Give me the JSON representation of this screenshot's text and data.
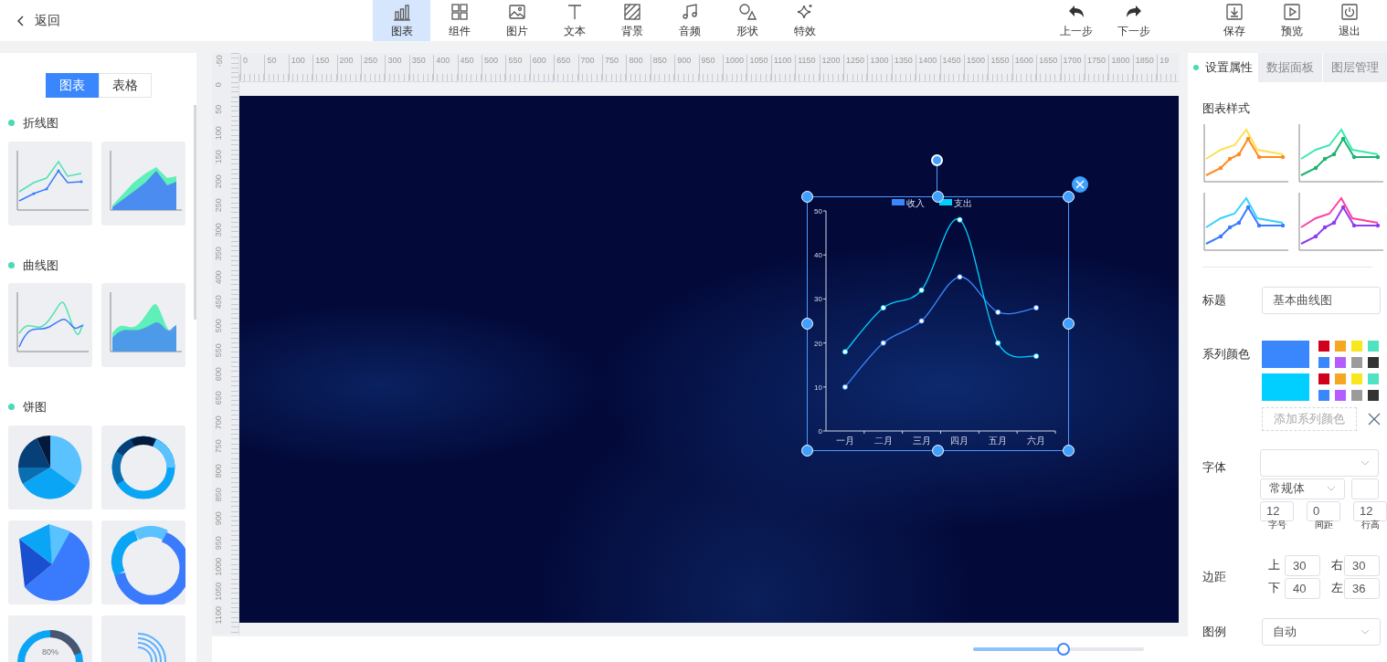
{
  "back": {
    "label": "返回"
  },
  "toolbar": {
    "tools": [
      {
        "label": "图表",
        "kind": "chart",
        "selected": true
      },
      {
        "label": "组件",
        "kind": "component",
        "selected": false
      },
      {
        "label": "图片",
        "kind": "image",
        "selected": false
      },
      {
        "label": "文本",
        "kind": "text",
        "selected": false
      },
      {
        "label": "背景",
        "kind": "background",
        "selected": false
      },
      {
        "label": "音频",
        "kind": "audio",
        "selected": false
      },
      {
        "label": "形状",
        "kind": "shape",
        "selected": false
      },
      {
        "label": "特效",
        "kind": "effect",
        "selected": false
      }
    ],
    "history": [
      {
        "label": "上一步",
        "kind": "undo"
      },
      {
        "label": "下一步",
        "kind": "redo"
      }
    ],
    "actions": [
      {
        "label": "保存",
        "kind": "save"
      },
      {
        "label": "预览",
        "kind": "preview"
      },
      {
        "label": "退出",
        "kind": "exit"
      }
    ]
  },
  "left_panel": {
    "tabs": [
      {
        "label": "图表",
        "selected": true
      },
      {
        "label": "表格",
        "selected": false
      }
    ],
    "sections": [
      {
        "title": "折线图",
        "items": [
          {
            "kind": "line"
          },
          {
            "kind": "area"
          }
        ]
      },
      {
        "title": "曲线图",
        "items": [
          {
            "kind": "curve"
          },
          {
            "kind": "curve-area"
          }
        ]
      },
      {
        "title": "饼图",
        "items": [
          {
            "kind": "pie"
          },
          {
            "kind": "donut"
          },
          {
            "kind": "rose-pie"
          },
          {
            "kind": "rose-donut"
          },
          {
            "kind": "gauge",
            "label": "80%"
          },
          {
            "kind": "radial-bars"
          }
        ]
      }
    ]
  },
  "rulers": {
    "horizontal": [
      "0",
      "50",
      "100",
      "150",
      "200",
      "250",
      "300",
      "350",
      "400",
      "450",
      "500",
      "550",
      "600",
      "650",
      "700",
      "750",
      "800",
      "850",
      "900",
      "950",
      "1000",
      "1050",
      "1100",
      "1150",
      "1200",
      "1250",
      "1300",
      "1350",
      "1400",
      "1450",
      "1500",
      "1550",
      "1600",
      "1650",
      "1700",
      "1750",
      "1800",
      "1850",
      "19"
    ],
    "vertical": [
      "-50",
      "0",
      "50",
      "100",
      "150",
      "200",
      "250",
      "300",
      "350",
      "400",
      "450",
      "500",
      "550",
      "600",
      "650",
      "700",
      "750",
      "800",
      "850",
      "900",
      "950",
      "1000",
      "1050",
      "1100"
    ]
  },
  "canvas": {
    "chart_data": {
      "type": "line",
      "categories": [
        "一月",
        "二月",
        "三月",
        "四月",
        "五月",
        "六月"
      ],
      "legend": "top",
      "series": [
        {
          "name": "收入",
          "color": "#3a87fd",
          "marker": "circle",
          "values": [
            10,
            20,
            25,
            35,
            27,
            28
          ]
        },
        {
          "name": "支出",
          "color": "#00cfff",
          "marker": "circle",
          "values": [
            18,
            28,
            32,
            48,
            20,
            17
          ]
        }
      ],
      "ylim": [
        0,
        50
      ],
      "yticks": [
        0,
        10,
        20,
        30,
        40,
        50
      ]
    }
  },
  "right_panel": {
    "tabs": [
      {
        "label": "设置属性",
        "selected": true
      },
      {
        "label": "数据面板",
        "selected": false
      },
      {
        "label": "图层管理",
        "selected": false
      }
    ],
    "chart_styles": {
      "title": "图表样式",
      "items": [
        {
          "lines": [
            {
              "color": "#ffe14d"
            },
            {
              "color": "#ff8a1f"
            }
          ]
        },
        {
          "lines": [
            {
              "color": "#3de8b0"
            },
            {
              "color": "#1db36e"
            }
          ]
        },
        {
          "lines": [
            {
              "color": "#36d1ff"
            },
            {
              "color": "#3a7bfd"
            }
          ]
        },
        {
          "lines": [
            {
              "color": "#ff3fa4"
            },
            {
              "color": "#8e3bf0"
            }
          ]
        }
      ]
    },
    "form": {
      "title": {
        "label": "标题",
        "value": "基本曲线图"
      },
      "series_colors": {
        "label": "系列颜色",
        "series": [
          {
            "color": "#3a87fd",
            "palette": [
              {
                "color": "#d0021b"
              },
              {
                "color": "#f5a623"
              },
              {
                "color": "#f8e71c"
              },
              {
                "color": "#50e3c2"
              },
              {
                "color": "#3a87fd"
              },
              {
                "color": "#b55cff"
              },
              {
                "color": "#9b9b9b"
              },
              {
                "color": "#333333"
              }
            ]
          },
          {
            "color": "#00cfff",
            "palette": [
              {
                "color": "#d0021b"
              },
              {
                "color": "#f5a623"
              },
              {
                "color": "#f8e71c"
              },
              {
                "color": "#50e3c2"
              },
              {
                "color": "#3a87fd"
              },
              {
                "color": "#b55cff"
              },
              {
                "color": "#9b9b9b"
              },
              {
                "color": "#333333"
              }
            ]
          }
        ],
        "add_button": "添加系列颜色"
      },
      "font": {
        "label": "字体",
        "style": "常规体",
        "size": {
          "value": "12",
          "label": "字号"
        },
        "spacing": {
          "value": "0",
          "label": "间距"
        },
        "line_height": {
          "value": "12",
          "label": "行高"
        }
      },
      "margin": {
        "label": "边距",
        "fields": [
          {
            "label": "上",
            "value": "30"
          },
          {
            "label": "右",
            "value": "30"
          },
          {
            "label": "下",
            "value": "40"
          },
          {
            "label": "左",
            "value": "36"
          }
        ]
      },
      "legend": {
        "label": "图例",
        "value": "自动"
      }
    }
  },
  "zoom_slider": {
    "level": 0.53
  }
}
